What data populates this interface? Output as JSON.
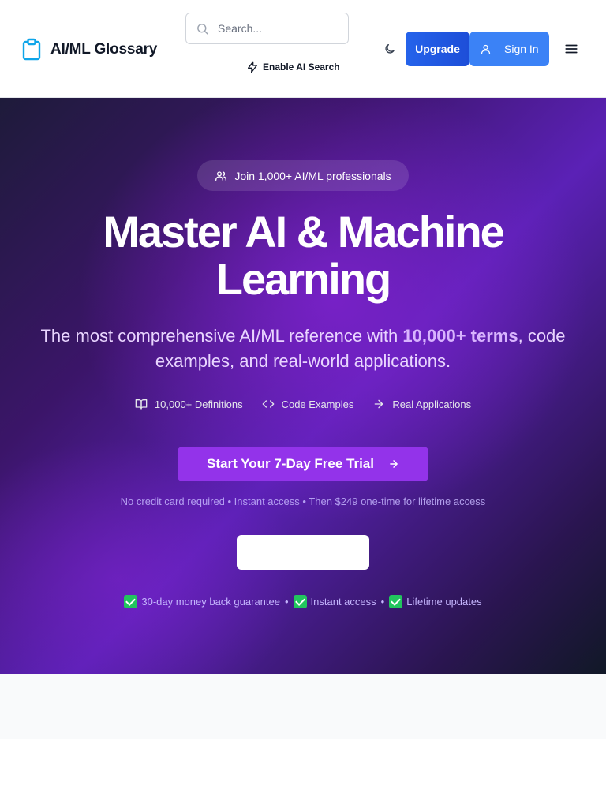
{
  "header": {
    "logo_text": "AI/ML Glossary",
    "search_placeholder": "Search...",
    "ai_search_label": "Enable AI Search",
    "upgrade_label": "Upgrade",
    "signin_label": "Sign In"
  },
  "hero": {
    "badge": "Join 1,000+ AI/ML professionals",
    "title_line1": "Master AI & Machine",
    "title_line2": "Learning",
    "subtitle_pre": "The most comprehensive AI/ML reference with ",
    "subtitle_strong": "10,000+ terms",
    "subtitle_post": ", code examples, and real-world applications.",
    "features": [
      {
        "icon": "book-icon",
        "label": "10,000+ Definitions"
      },
      {
        "icon": "code-icon",
        "label": "Code Examples"
      },
      {
        "icon": "arrow-right-icon",
        "label": "Real Applications"
      }
    ],
    "cta_label": "Start Your 7-Day Free Trial",
    "cta_note": "No credit card required • Instant access • Then $249 one-time for lifetime access",
    "guarantees": [
      "30-day money back guarantee",
      "Instant access",
      "Lifetime updates"
    ],
    "separator": "•"
  },
  "colors": {
    "accent": "#9333ea",
    "upgrade": "#2563eb",
    "signin": "#3b82f6",
    "logo_icon": "#0ea5e9"
  }
}
